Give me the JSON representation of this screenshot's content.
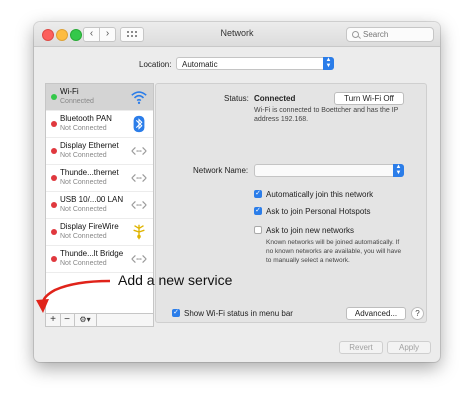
{
  "window": {
    "title": "Network"
  },
  "toolbar": {
    "back_label": "‹",
    "forward_label": "›",
    "search_placeholder": "Search"
  },
  "location": {
    "label": "Location:",
    "value": "Automatic"
  },
  "services": [
    {
      "name": "Wi-Fi",
      "status": "Connected",
      "status_color": "#34c84a",
      "icon": "wifi-icon"
    },
    {
      "name": "Bluetooth PAN",
      "status": "Not Connected",
      "status_color": "#e0383e",
      "icon": "bluetooth-icon"
    },
    {
      "name": "Display Ethernet",
      "status": "Not Connected",
      "status_color": "#e0383e",
      "icon": "ethernet-arrows-icon"
    },
    {
      "name": "Thunde...thernet",
      "status": "Not Connected",
      "status_color": "#e0383e",
      "icon": "ethernet-arrows-icon"
    },
    {
      "name": "USB 10/...00 LAN",
      "status": "Not Connected",
      "status_color": "#e0383e",
      "icon": "ethernet-arrows-icon"
    },
    {
      "name": "Display FireWire",
      "status": "Not Connected",
      "status_color": "#e0383e",
      "icon": "firewire-icon"
    },
    {
      "name": "Thunde...lt Bridge",
      "status": "Not Connected",
      "status_color": "#e0383e",
      "icon": "ethernet-arrows-icon"
    }
  ],
  "sidebar_footer": {
    "add_label": "+",
    "remove_label": "−",
    "action_label": "⚙▾"
  },
  "detail": {
    "status_label": "Status:",
    "status_value": "Connected",
    "turn_off_button": "Turn Wi-Fi Off",
    "status_description_line1": "Wi-Fi is connected to Boettcher and has the IP",
    "status_description_line2": "address 192.168.",
    "network_name_label": "Network Name:",
    "network_name_value": "",
    "auto_join_label": "Automatically join this network",
    "hotspots_label": "Ask to join Personal Hotspots",
    "ask_new_label": "Ask to join new networks",
    "ask_new_desc_line1": "Known networks will be joined automatically. If",
    "ask_new_desc_line2": "no known networks are available, you will have",
    "ask_new_desc_line3": "to manually select a network.",
    "show_status_label": "Show Wi-Fi status in menu bar",
    "advanced_button": "Advanced...",
    "help_label": "?"
  },
  "bottom": {
    "revert_button": "Revert",
    "apply_button": "Apply"
  },
  "annotation": {
    "text": "Add a new service",
    "arrow_color": "#e0231a"
  },
  "colors": {
    "accent": "#2b7de9",
    "connected": "#34c84a",
    "disconnected": "#e0383e"
  }
}
